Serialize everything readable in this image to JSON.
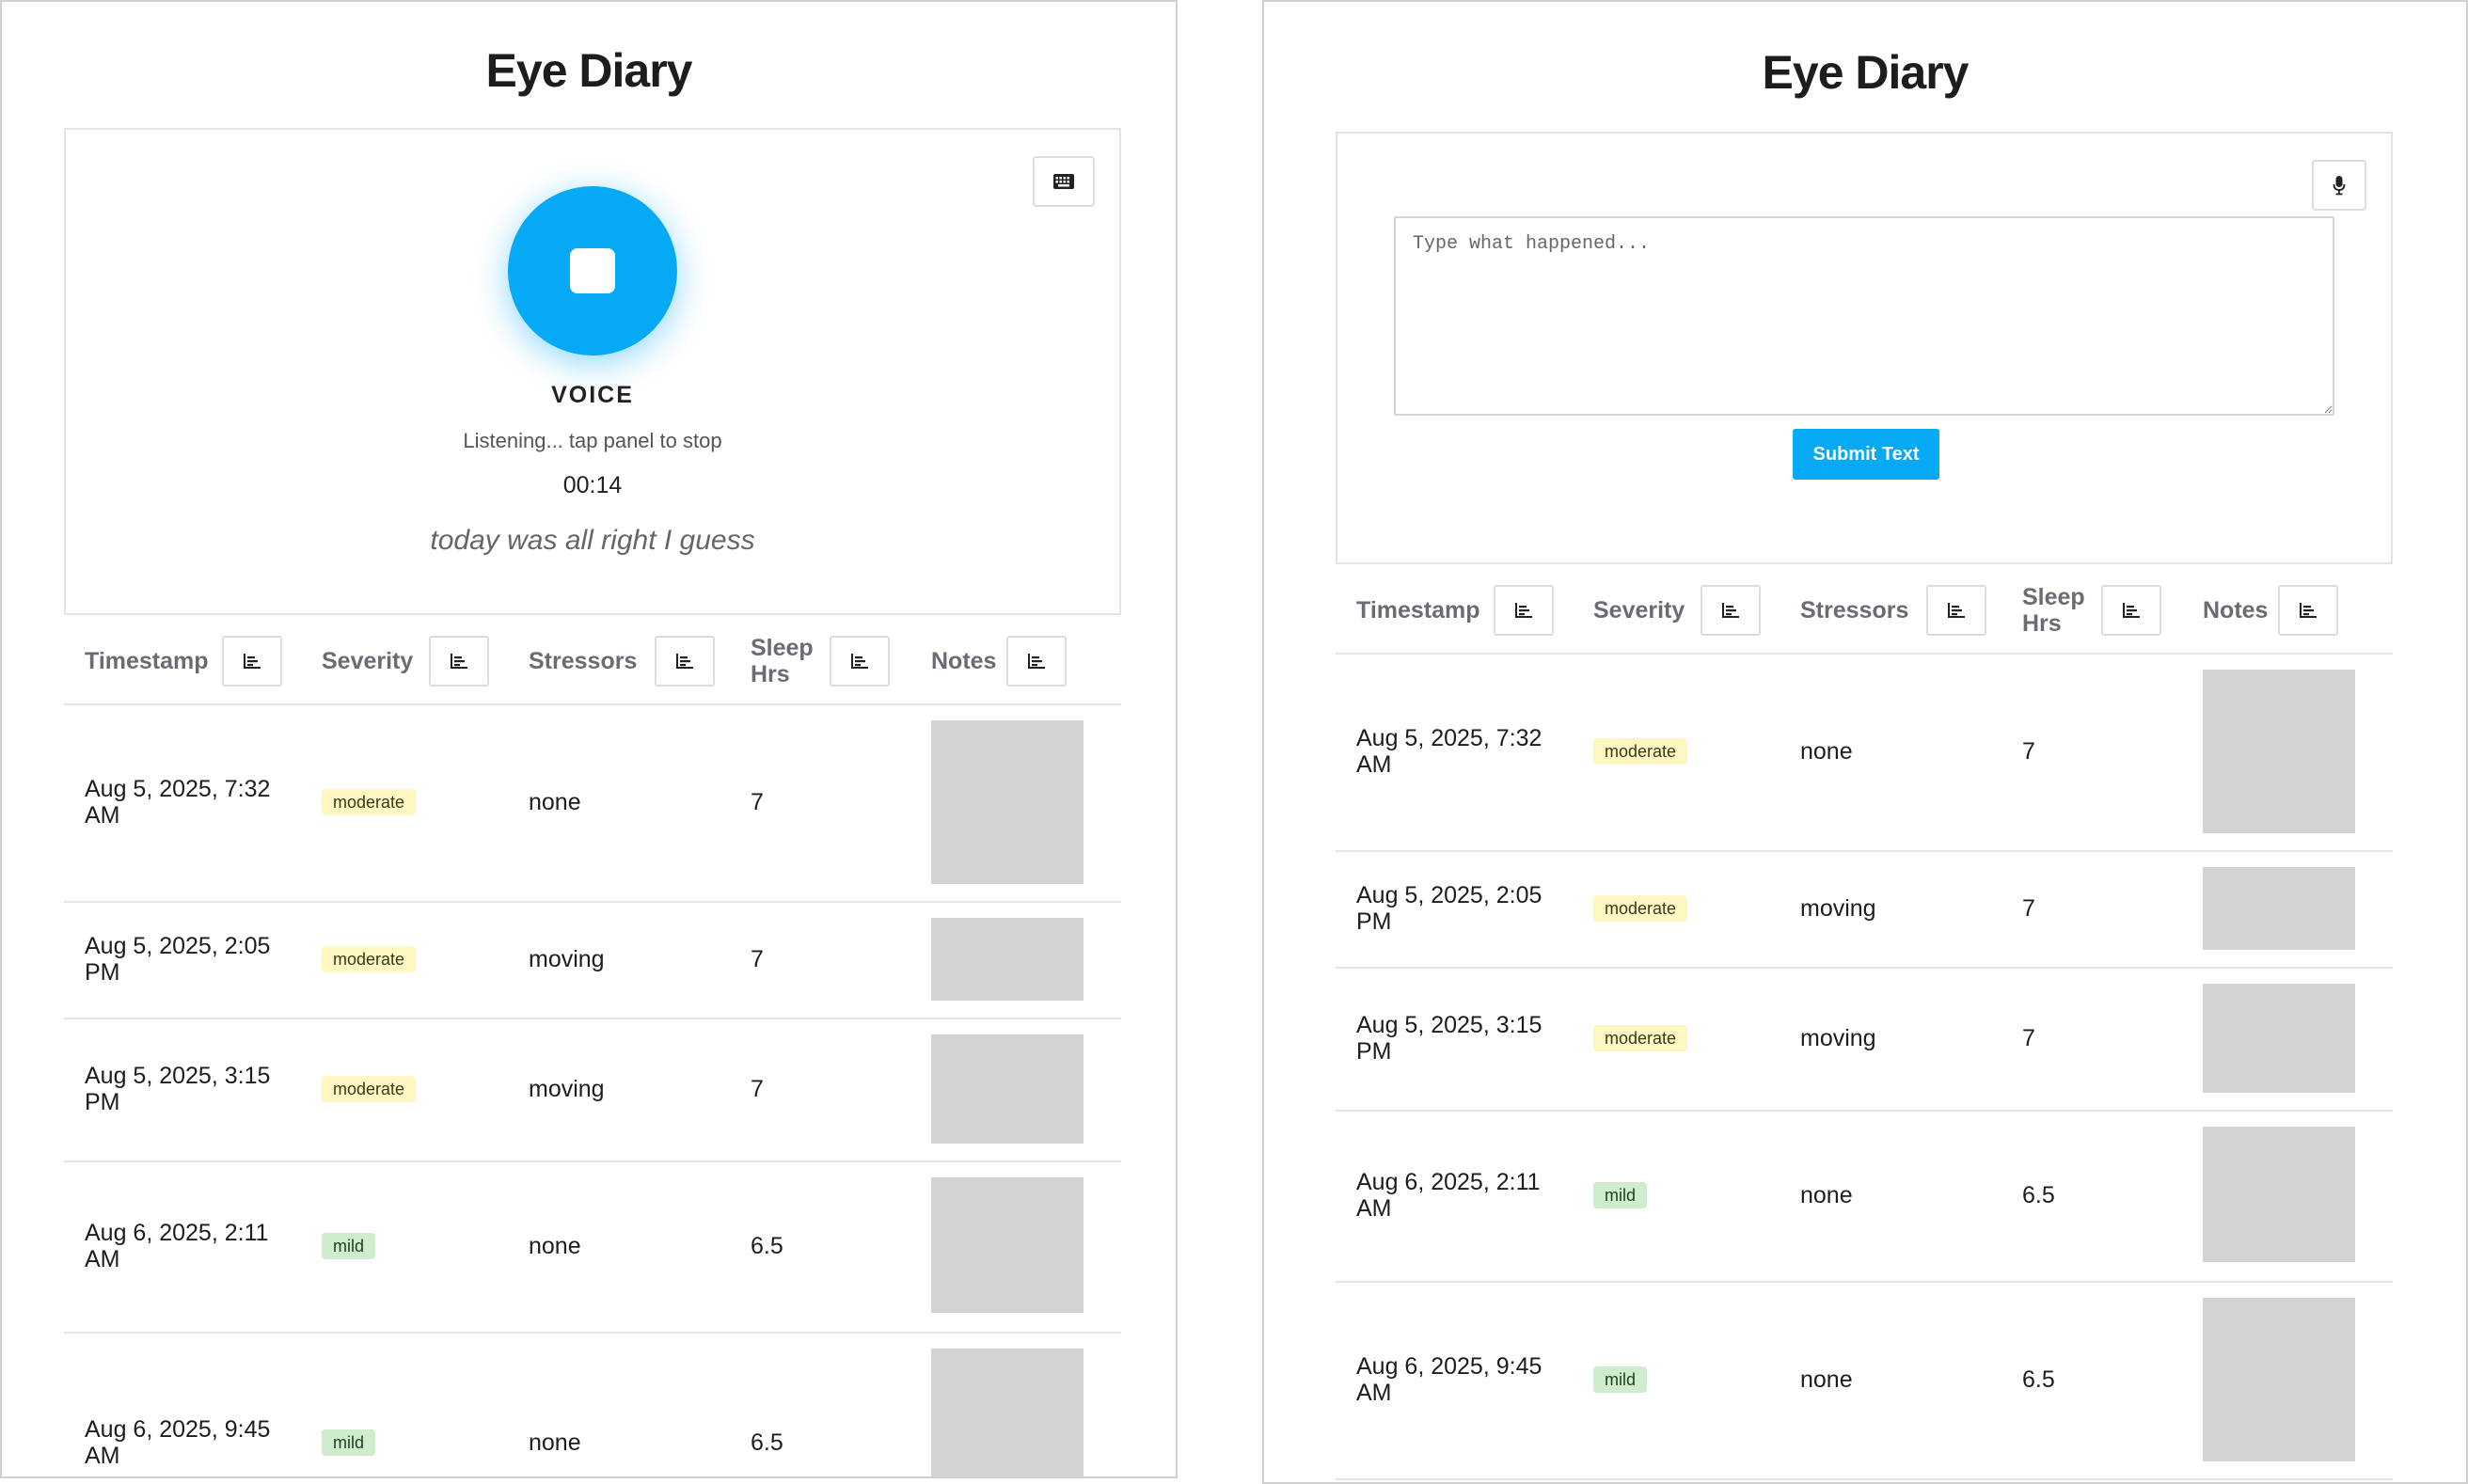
{
  "colors": {
    "accent": "#06a9f4",
    "moderate_badge": "#fff7c2",
    "mild_badge": "#cfeccf",
    "notes_placeholder": "#d3d3d3"
  },
  "left": {
    "title": "Eye Diary",
    "keyboard_icon": "keyboard-icon",
    "voice_label": "VOICE",
    "status": "Listening... tap panel to stop",
    "timer": "00:14",
    "transcript": "today was all right I guess"
  },
  "right": {
    "title": "Eye Diary",
    "mic_icon": "microphone-icon",
    "textarea_placeholder": "Type what happened...",
    "submit_label": "Submit Text"
  },
  "table": {
    "columns": [
      {
        "label": "Timestamp",
        "icon": "bar-chart-icon"
      },
      {
        "label": "Severity",
        "icon": "bar-chart-icon"
      },
      {
        "label": "Stressors",
        "icon": "bar-chart-icon"
      },
      {
        "label": "Sleep Hrs",
        "icon": "bar-chart-icon"
      },
      {
        "label": "Notes",
        "icon": "bar-chart-icon"
      }
    ],
    "rows": [
      {
        "timestamp": "Aug 5, 2025, 7:32 AM",
        "severity": "moderate",
        "stressors": "none",
        "sleep": "7"
      },
      {
        "timestamp": "Aug 5, 2025, 2:05 PM",
        "severity": "moderate",
        "stressors": "moving",
        "sleep": "7"
      },
      {
        "timestamp": "Aug 5, 2025, 3:15 PM",
        "severity": "moderate",
        "stressors": "moving",
        "sleep": "7"
      },
      {
        "timestamp": "Aug 6, 2025, 2:11 AM",
        "severity": "mild",
        "stressors": "none",
        "sleep": "6.5"
      },
      {
        "timestamp": "Aug 6, 2025, 9:45 AM",
        "severity": "mild",
        "stressors": "none",
        "sleep": "6.5"
      }
    ]
  }
}
